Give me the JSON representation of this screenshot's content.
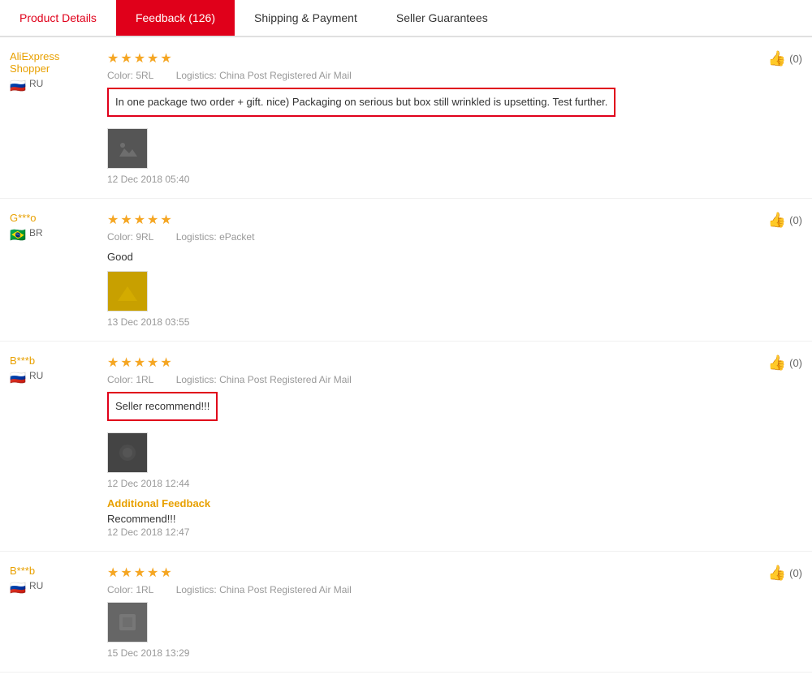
{
  "tabs": [
    {
      "id": "product-details",
      "label": "Product Details",
      "active": false
    },
    {
      "id": "feedback",
      "label": "Feedback (126)",
      "active": true
    },
    {
      "id": "shipping-payment",
      "label": "Shipping & Payment",
      "active": false
    },
    {
      "id": "seller-guarantees",
      "label": "Seller Guarantees",
      "active": false
    }
  ],
  "reviews": [
    {
      "id": 1,
      "username": "AliExpress Shopper",
      "country_code": "RU",
      "country_flag": "🇷🇺",
      "stars": 5,
      "color": "5RL",
      "logistics": "China Post Registered Air Mail",
      "text": "In one package two order + gift. nice) Packaging on serious but box still wrinkled is upsetting. Test further.",
      "text_highlighted": true,
      "has_image": true,
      "image_class": "image-box-1",
      "date": "12 Dec 2018 05:40",
      "likes": 0,
      "additional_feedback": null
    },
    {
      "id": 2,
      "username": "G***o",
      "country_code": "BR",
      "country_flag": "🇧🇷",
      "stars": 5,
      "color": "9RL",
      "logistics": "ePacket",
      "text": "Good",
      "text_highlighted": false,
      "has_image": true,
      "image_class": "image-box-2",
      "date": "13 Dec 2018 03:55",
      "likes": 0,
      "additional_feedback": null
    },
    {
      "id": 3,
      "username": "B***b",
      "country_code": "RU",
      "country_flag": "🇷🇺",
      "stars": 5,
      "color": "1RL",
      "logistics": "China Post Registered Air Mail",
      "text": "Seller recommend!!!",
      "text_highlighted": true,
      "has_image": true,
      "image_class": "image-box-3",
      "date": "12 Dec 2018 12:44",
      "likes": 0,
      "additional_feedback": {
        "label": "Additional Feedback",
        "text": "Recommend!!!",
        "date": "12 Dec 2018 12:47"
      }
    },
    {
      "id": 4,
      "username": "B***b",
      "country_code": "RU",
      "country_flag": "🇷🇺",
      "stars": 5,
      "color": "1RL",
      "logistics": "China Post Registered Air Mail",
      "text": null,
      "text_highlighted": false,
      "has_image": true,
      "image_class": "image-box-4",
      "date": "15 Dec 2018 13:29",
      "likes": 0,
      "additional_feedback": null
    }
  ],
  "like_label": "(0)"
}
